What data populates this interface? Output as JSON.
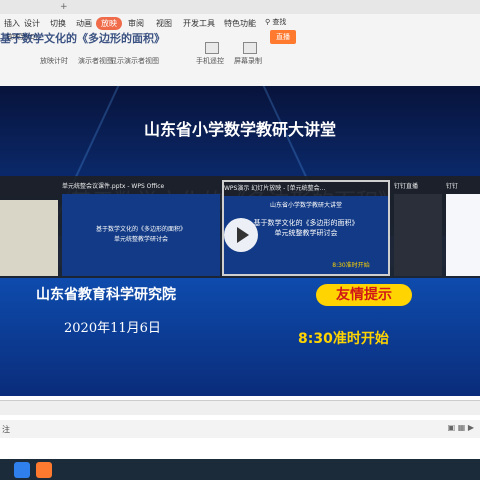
{
  "ribbon": {
    "tabs": [
      "插入",
      "设计",
      "切换",
      "动画",
      "放映",
      "审阅",
      "视图",
      "开发工具",
      "特色功能"
    ],
    "active_tab": "放映",
    "search_label": "查找",
    "video_button": "直播",
    "tools": [
      "手机遥控",
      "屏幕录制"
    ],
    "options": [
      "放映到(O)",
      "放映计时",
      "演示者视图",
      "显示演示者视图"
    ]
  },
  "slide": {
    "title": "山东省小学数学教研大讲堂",
    "background_line": "基于数学文化的《多边形的面积》",
    "org": "山东省教育科学研究院",
    "date": "2020年11月6日",
    "reminder": "友情提示",
    "start_time": "8:30准时开始"
  },
  "switcher": {
    "cards": [
      {
        "label": "单元统整会议课件.pptx - WPS Office"
      },
      {
        "label": "WPS演示 幻灯片放映 - [单元统整会..."
      },
      {
        "label": "钉钉直播"
      },
      {
        "label": "钉钉"
      }
    ],
    "mini2_lines": [
      "基于数学文化的《多边形的面积》",
      "单元统整教学研讨会"
    ],
    "mini3_lines": [
      "山东省小学数学教研大讲堂",
      "基于数学文化的《多边形的面积》",
      "单元统整教学研讨会",
      "8:30准时开始"
    ]
  },
  "status": {
    "text": "注"
  },
  "colors": {
    "accent": "#ef6b4a",
    "reminder_bg": "#ffd400",
    "start_text": "#ffd400"
  }
}
